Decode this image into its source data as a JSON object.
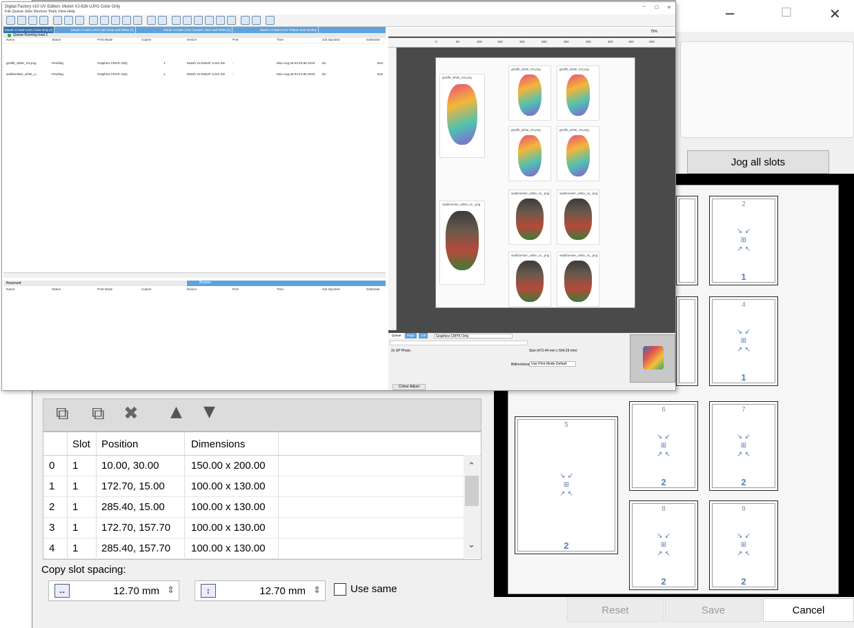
{
  "bg_dialog": {
    "jog_all_slots": "Jog all slots",
    "slots": [
      {
        "num": "2",
        "count": "1"
      },
      {
        "num": "4",
        "count": "1"
      },
      {
        "num": "5",
        "count": "2"
      },
      {
        "num": "6",
        "count": "2"
      },
      {
        "num": "7",
        "count": "2"
      },
      {
        "num": "8",
        "count": "2"
      },
      {
        "num": "9",
        "count": "2"
      }
    ],
    "grid": {
      "columns": [
        "Slot",
        "Position",
        "Dimensions"
      ],
      "rows": [
        {
          "idx": "0",
          "slot": "1",
          "position": "10.00, 30.00",
          "dimensions": "150.00 x 200.00"
        },
        {
          "idx": "1",
          "slot": "1",
          "position": "172.70, 15.00",
          "dimensions": "100.00 x 130.00"
        },
        {
          "idx": "2",
          "slot": "1",
          "position": "285.40, 15.00",
          "dimensions": "100.00 x 130.00"
        },
        {
          "idx": "3",
          "slot": "1",
          "position": "172.70, 157.70",
          "dimensions": "100.00 x 130.00"
        },
        {
          "idx": "4",
          "slot": "1",
          "position": "285.40, 157.70",
          "dimensions": "100.00 x 130.00"
        }
      ]
    },
    "copy_slot_spacing": "Copy slot spacing:",
    "spacing_h": "12.70 mm",
    "spacing_v": "12.70 mm",
    "use_same": "Use same",
    "reset": "Reset",
    "save": "Save",
    "cancel": "Cancel"
  },
  "df": {
    "title": "Digital Factory v10 UV Edition: Mutoh VJ-626 UJH1 Color Only",
    "menu": "File  Queue  Jobs  Devices  Tools  View  Help",
    "tabs": [
      "Mutoh VJ-626 UJH1 Color Only [2]",
      "Mutoh VJ-626 UJH1 Auto Clear and White [7]",
      "Mutoh VJ-626 UJH1 Custom Clear and White [1]",
      "Mutoh VJ-626 UJH1 Tiebars and Overlay"
    ],
    "queue_status": "Queue Running  total 2",
    "columns": [
      "Name",
      "Status",
      "Print Mode",
      "Copies",
      "Device",
      "Port",
      "Time",
      "Job Spooled",
      "Substrate"
    ],
    "jobs": [
      {
        "name": "giraffe_white_XS.png",
        "status": "Pending",
        "mode": "Graphics CMYK Only",
        "copies": "1",
        "device": "Mutoh VJ-626UF UJH1 Ink",
        "port": "-",
        "time": "Mon Aug 28 04:20:58 2019",
        "spooled": "No",
        "sub": "Non"
      },
      {
        "name": "waldmeister_white_x...",
        "status": "Pending",
        "mode": "Graphics CMYK Only",
        "copies": "1",
        "device": "Mutoh VJ-626UF UJH1 Ink",
        "port": "-",
        "time": "Mon Aug 28 04:21:08 2019",
        "spooled": "No",
        "sub": "Non"
      }
    ],
    "reserved": "Reserved",
    "browse": "Browse",
    "ruler": [
      "0",
      "50",
      "100",
      "150",
      "200",
      "250",
      "300",
      "350",
      "400",
      "450",
      "500"
    ],
    "zoom": "75%",
    "thumbs": {
      "giraffe_big": "giraffe_white_XS.png",
      "giraffe_small": "giraffe_white_XS.png",
      "wald_big": "waldmeister_white_xs_.png",
      "wald_small": "waldmeister_white_xs_.png"
    },
    "bottom_tabs": [
      "Queue",
      "Page",
      "Job"
    ],
    "print_mode": "Graphics CMYK Only",
    "layout": "2x UP Photo",
    "size": "Size (472.44 mm x 504.29 mm)",
    "bidirectional": "Bidirectional",
    "bidi_value": "Use Print Mode Default",
    "colour_adjust": "Colour Adjust"
  }
}
